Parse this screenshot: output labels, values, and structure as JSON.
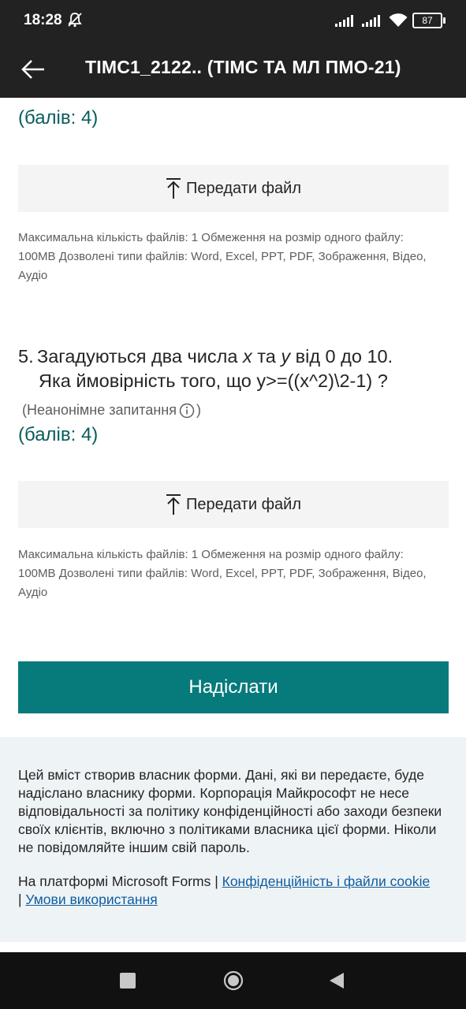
{
  "status_bar": {
    "time": "18:28",
    "battery": "87",
    "icons": [
      "mute-icon",
      "signal-icon",
      "signal-icon",
      "wifi-icon",
      "battery-icon"
    ]
  },
  "app_bar": {
    "title": "ТІМС1_2122.. (ТІМС ТА МЛ ПМО-21)",
    "back_icon": "arrow-left-icon"
  },
  "question4": {
    "points": "(балів: 4)",
    "upload_label": "Передати файл",
    "file_info": "Максимальна кількість файлів: 1    Обмеження на розмір одного файлу: 100MB    Дозволені типи файлів: Word, Excel, PPT, PDF, Зображення, Відео, Аудіо"
  },
  "question5": {
    "number": "5.",
    "title_line1_a": "Загадуються два числа ",
    "var_x": "x",
    "title_line1_b": " та ",
    "var_y": "y",
    "title_line1_c": " від 0 до 10.",
    "title_line2": "Яка ймовірність того, що y>=((x^2)\\2-1) ?",
    "note_open": "(Неанонімне запитання",
    "note_close": ")",
    "points": "(балів: 4)",
    "upload_label": "Передати файл",
    "file_info": "Максимальна кількість файлів: 1    Обмеження на розмір одного файлу: 100MB    Дозволені типи файлів: Word, Excel, PPT, PDF, Зображення, Відео, Аудіо"
  },
  "submit_label": "Надіслати",
  "footer": {
    "disclaimer": "Цей вміст створив власник форми. Дані, які ви передаєте, буде надіслано власнику форми. Корпорація Майкрософт не несе відповідальності за політику конфіденційності або заходи безпеки своїх клієнтів, включно з політиками власника цієї форми. Ніколи не повідомляйте іншим свій пароль.",
    "platform": "На платформі Microsoft Forms | ",
    "privacy_link": "Конфіденційність і файли cookie",
    "separator": "| ",
    "terms_link": "Умови використання"
  },
  "colors": {
    "accent": "#077a7c",
    "points": "#0b5c5e",
    "link": "#0f5d9e",
    "footer_bg": "#eef3f6",
    "bar_bg": "#222222"
  }
}
